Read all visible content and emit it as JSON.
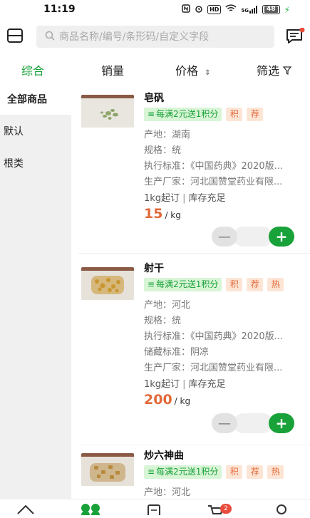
{
  "status_bar": {
    "time": "11:19",
    "hd": "HD",
    "signal": "5G",
    "battery": "48"
  },
  "search": {
    "placeholder": "商品名称/编号/条形码/自定义字段"
  },
  "sort_tabs": {
    "all": "综合",
    "sales": "销量",
    "price": "价格",
    "filter": "筛选"
  },
  "sidebar": {
    "items": [
      {
        "label": "全部商品"
      },
      {
        "label": "默认"
      },
      {
        "label": "根类"
      }
    ]
  },
  "products": [
    {
      "name": "皂矾",
      "promo": "每满2元送1积分",
      "tags": [
        "积",
        "荐"
      ],
      "origin_label": "产地：",
      "origin": "湖南",
      "spec_label": "规格：",
      "spec": "统",
      "standard_label": "执行标准：",
      "standard": "《中国药典》2020版...",
      "maker_label": "生产厂家：",
      "maker": "河北国赞堂药业有限...",
      "moq": "1kg起订",
      "stock": "库存充足",
      "price": "15",
      "unit": "/ kg"
    },
    {
      "name": "射干",
      "promo": "每满2元送1积分",
      "tags": [
        "积",
        "荐",
        "热"
      ],
      "origin_label": "产地：",
      "origin": "河北",
      "spec_label": "规格：",
      "spec": "统",
      "standard_label": "执行标准：",
      "standard": "《中国药典》2020版...",
      "storage_label": "储藏标准：",
      "storage": "阴凉",
      "maker_label": "生产厂家：",
      "maker": "河北国赞堂药业有限...",
      "moq": "1kg起订",
      "stock": "库存充足",
      "price": "200",
      "unit": "/ kg"
    },
    {
      "name": "炒六神曲",
      "promo": "每满2元送1积分",
      "tags": [
        "积",
        "荐",
        "热"
      ],
      "origin_label": "产地：",
      "origin": "河北"
    }
  ],
  "cart_badge": "2",
  "colors": {
    "accent": "#1aa23a",
    "price": "#e26a3b",
    "badge": "#e94b3c"
  }
}
